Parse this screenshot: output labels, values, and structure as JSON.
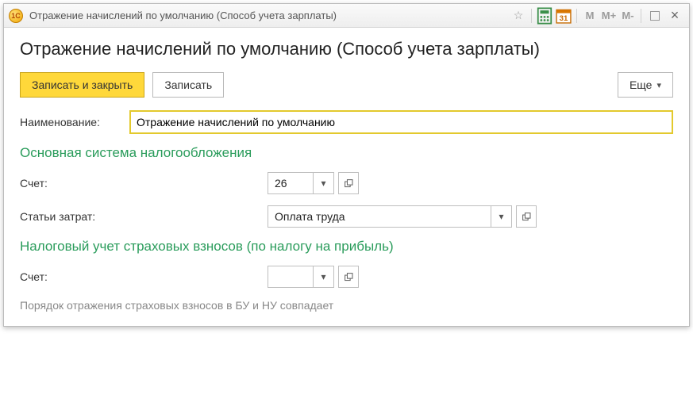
{
  "window": {
    "title": "Отражение начислений по умолчанию (Способ учета зарплаты)",
    "app_icon_text": "1С"
  },
  "titlebar_tools": {
    "star": "☆",
    "calc": "▦",
    "cal": "31",
    "m": "M",
    "mplus": "M+",
    "mminus": "M-",
    "close": "×"
  },
  "page": {
    "title": "Отражение начислений по умолчанию (Способ учета зарплаты)"
  },
  "toolbar": {
    "save_close": "Записать и закрыть",
    "save": "Записать",
    "more": "Еще"
  },
  "fields": {
    "name_label": "Наименование:",
    "name_value": "Отражение начислений по умолчанию"
  },
  "section1": {
    "title": "Основная система налогообложения",
    "account_label": "Счет:",
    "account_value": "26",
    "cost_items_label": "Статьи затрат:",
    "cost_items_value": "Оплата труда"
  },
  "section2": {
    "title": "Налоговый учет страховых взносов (по налогу на прибыль)",
    "account_label": "Счет:",
    "account_value": ""
  },
  "footer_note": "Порядок отражения страховых взносов в БУ и НУ совпадает"
}
